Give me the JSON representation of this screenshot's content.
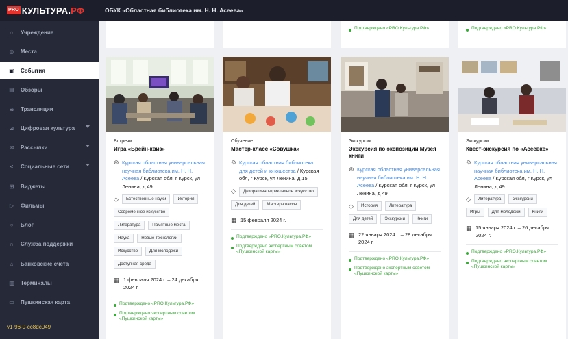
{
  "brand": {
    "pro": "PRO",
    "name": "КУЛЬТУРА.",
    "suffix": "РФ"
  },
  "header": {
    "org_title": "ОБУК «Областная библиотека им. Н. Н. Асеева»"
  },
  "sidebar": {
    "items": [
      {
        "label": "Учреждение",
        "icon": "home-icon",
        "glyph": "⌂"
      },
      {
        "label": "Места",
        "icon": "location-icon",
        "glyph": "◎"
      },
      {
        "label": "События",
        "icon": "calendar-icon",
        "glyph": "▣",
        "active": true
      },
      {
        "label": "Обзоры",
        "icon": "document-icon",
        "glyph": "▤"
      },
      {
        "label": "Трансляции",
        "icon": "broadcast-icon",
        "glyph": "≋"
      },
      {
        "label": "Цифровая культура",
        "icon": "chart-icon",
        "glyph": "⊿",
        "dropdown": true
      },
      {
        "label": "Рассылки",
        "icon": "mail-icon",
        "glyph": "✉",
        "dropdown": true
      },
      {
        "label": "Социальные сети",
        "icon": "share-icon",
        "glyph": "<",
        "dropdown": true
      },
      {
        "label": "Виджеты",
        "icon": "widgets-icon",
        "glyph": "⊞"
      },
      {
        "label": "Фильмы",
        "icon": "video-icon",
        "glyph": "▷"
      },
      {
        "label": "Блог",
        "icon": "chat-icon",
        "glyph": "○"
      },
      {
        "label": "Служба поддержки",
        "icon": "headset-icon",
        "glyph": "∩"
      },
      {
        "label": "Банковские счета",
        "icon": "bank-icon",
        "glyph": "⌂"
      },
      {
        "label": "Терминалы",
        "icon": "terminal-icon",
        "glyph": "▥"
      },
      {
        "label": "Пушкинская карта",
        "icon": "card-icon",
        "glyph": "▭"
      }
    ],
    "version": "v1-96-0-cc8dc049"
  },
  "top_cards": [
    {
      "verified": []
    },
    {
      "verified": []
    },
    {
      "verified": [
        "Подтверждено «PRO.Культура.РФ»"
      ]
    },
    {
      "verified": [
        "Подтверждено «PRO.Культура.РФ»"
      ]
    }
  ],
  "events": [
    {
      "category": "Встречи",
      "title": "Игра «Брейн-квиз»",
      "address_link": "Курская областная универсальная научная библиотека им. Н. Н. Асеева",
      "address_rest": " / Курская обл, г Курск, ул Ленина, д 49",
      "tags": [
        "Естественные науки",
        "История",
        "Современное искусство",
        "Литература",
        "Памятные места",
        "Наука",
        "Новые технологии",
        "Искусство",
        "Для молодежи",
        "Доступная среда"
      ],
      "date": "1 февраля 2024 г. – 24 декабря 2024 г.",
      "verified": [
        "Подтверждено «PRO.Культура.РФ»",
        "Подтверждено экспертным советом «Пушкинской карты»"
      ]
    },
    {
      "category": "Обучение",
      "title": "Мастер-класс «Совушка»",
      "address_link": "Курская областная библиотека для детей и юношества",
      "address_rest": " / Курская обл, г Курск, ул Ленина, д 15",
      "tags": [
        "Декоративно-прикладное искусство",
        "Для детей",
        "Мастер-классы"
      ],
      "date": "15 февраля 2024 г.",
      "verified": [
        "Подтверждено «PRO.Культура.РФ»",
        "Подтверждено экспертным советом «Пушкинской карты»"
      ]
    },
    {
      "category": "Экскурсии",
      "title": "Экскурсия по экспозиции Музея книги",
      "address_link": "Курская областная универсальная научная библиотека им. Н. Н. Асеева",
      "address_rest": " / Курская обл, г Курск, ул Ленина, д 49",
      "tags": [
        "История",
        "Литература",
        "Для детей",
        "Экскурсии",
        "Книги"
      ],
      "date": "22 января 2024 г. – 28 декабря 2024 г.",
      "verified": [
        "Подтверждено «PRO.Культура.РФ»",
        "Подтверждено экспертным советом «Пушкинской карты»"
      ]
    },
    {
      "category": "Экскурсии",
      "title": "Квест-экскурсия по «Асеевке»",
      "address_link": "Курская областная универсальная научная библиотека им. Н. Н. Асеева",
      "address_rest": " / Курская обл, г Курск, ул Ленина, д 49",
      "tags": [
        "Литература",
        "Экскурсии",
        "Игры",
        "Для молодежи",
        "Книги"
      ],
      "date": "15 января 2024 г. – 26 декабря 2024 г.",
      "verified": [
        "Подтверждено «PRO.Культура.РФ»",
        "Подтверждено экспертным советом «Пушкинской карты»"
      ]
    }
  ]
}
